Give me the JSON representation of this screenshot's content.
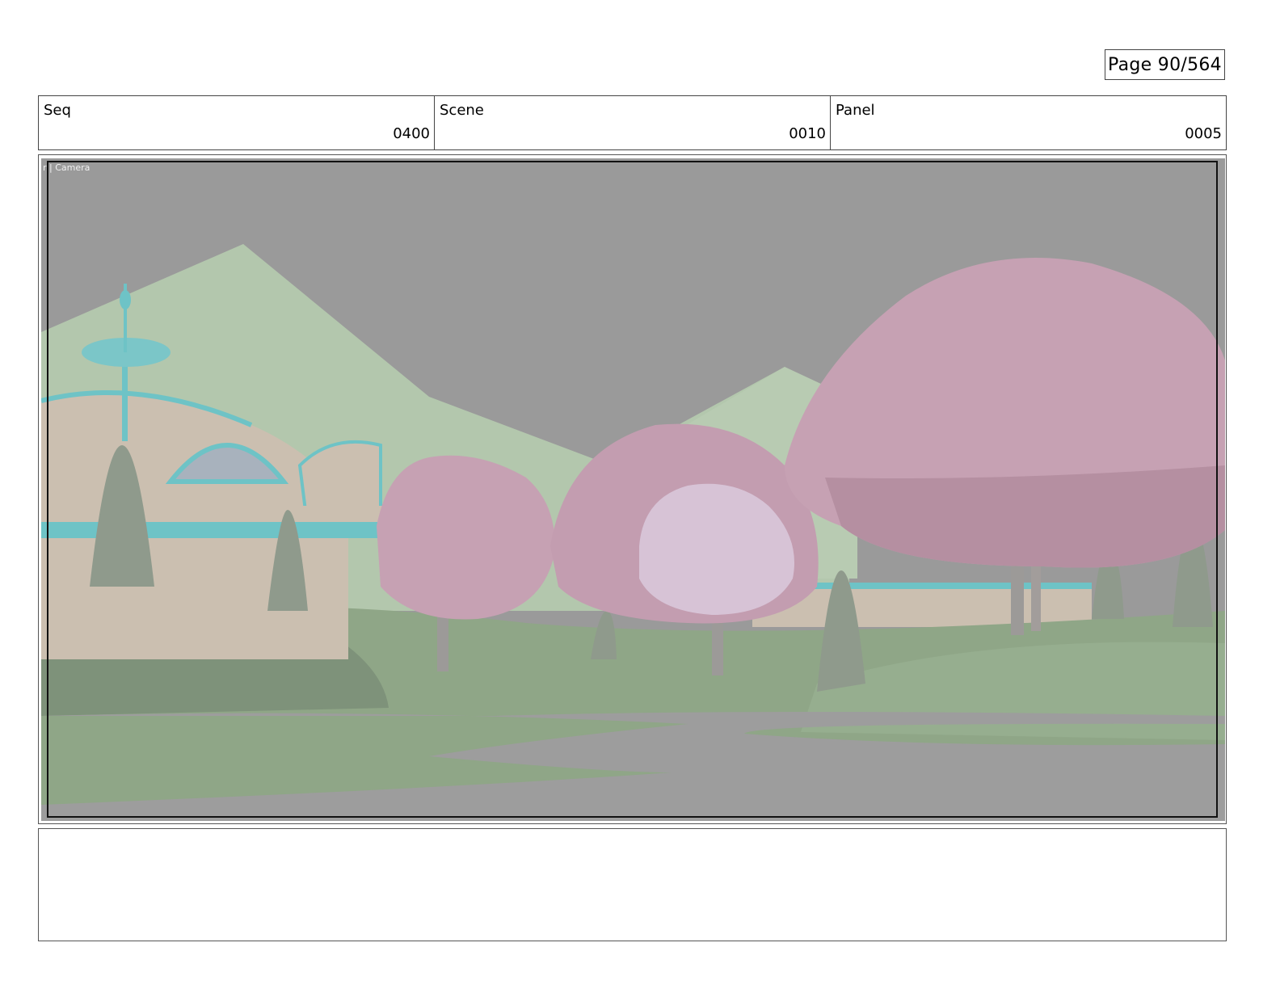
{
  "page": {
    "label": "Page",
    "number": "90/564"
  },
  "header": {
    "seq": {
      "label": "Seq",
      "value": "0400"
    },
    "scene": {
      "label": "Scene",
      "value": "0010"
    },
    "panel": {
      "label": "Panel",
      "value": "0005"
    }
  },
  "viewport": {
    "camera_label": "r | Camera",
    "colors": {
      "sky": "#9a9a9a",
      "mountain": "#b3c7ad",
      "tree_pink": "#c6a1b3",
      "tree_light": "#d7c3d6",
      "building": "#cbbfb0",
      "trim": "#6ec3c6",
      "grass": "#8fa687",
      "trunk": "#9c9a98"
    }
  },
  "notes": {
    "text": ""
  }
}
